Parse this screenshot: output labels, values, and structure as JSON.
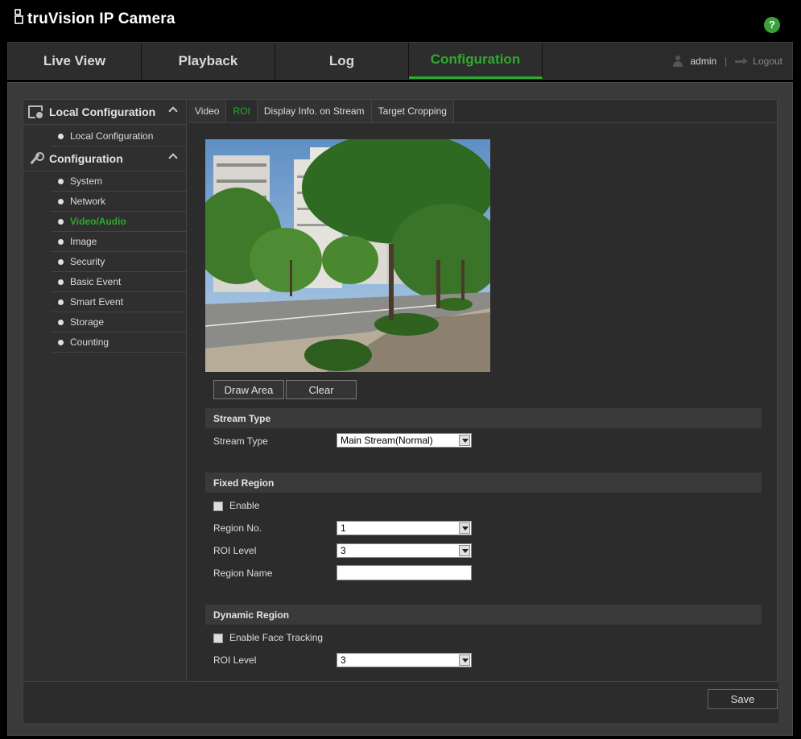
{
  "brand": {
    "name": "truVision  IP Camera"
  },
  "help": {
    "label": "?"
  },
  "topnav": {
    "tabs": [
      {
        "label": "Live View",
        "active": false
      },
      {
        "label": "Playback",
        "active": false
      },
      {
        "label": "Log",
        "active": false
      },
      {
        "label": "Configuration",
        "active": true
      }
    ],
    "user": "admin",
    "separator": "|",
    "logout": "Logout"
  },
  "sidebar": {
    "local": {
      "title": "Local Configuration",
      "items": [
        {
          "label": "Local Configuration"
        }
      ]
    },
    "config": {
      "title": "Configuration",
      "items": [
        {
          "label": "System"
        },
        {
          "label": "Network"
        },
        {
          "label": "Video/Audio",
          "active": true
        },
        {
          "label": "Image"
        },
        {
          "label": "Security"
        },
        {
          "label": "Basic Event"
        },
        {
          "label": "Smart Event"
        },
        {
          "label": "Storage"
        },
        {
          "label": "Counting"
        }
      ]
    }
  },
  "subtabs": [
    {
      "label": "Video"
    },
    {
      "label": "ROI",
      "active": true
    },
    {
      "label": "Display Info. on Stream"
    },
    {
      "label": "Target Cropping"
    }
  ],
  "buttons": {
    "draw_area": "Draw Area",
    "clear": "Clear",
    "save": "Save"
  },
  "stream": {
    "section": "Stream Type",
    "label": "Stream Type",
    "value": "Main Stream(Normal)"
  },
  "fixed": {
    "section": "Fixed Region",
    "enable": "Enable",
    "region_no_label": "Region No.",
    "region_no_value": "1",
    "roi_level_label": "ROI Level",
    "roi_level_value": "3",
    "region_name_label": "Region Name",
    "region_name_value": ""
  },
  "dynamic": {
    "section": "Dynamic Region",
    "face_tracking": "Enable Face Tracking",
    "roi_level_label": "ROI Level",
    "roi_level_value": "3"
  },
  "colors": {
    "accent": "#2eaa2e",
    "help": "#3aa13a"
  }
}
